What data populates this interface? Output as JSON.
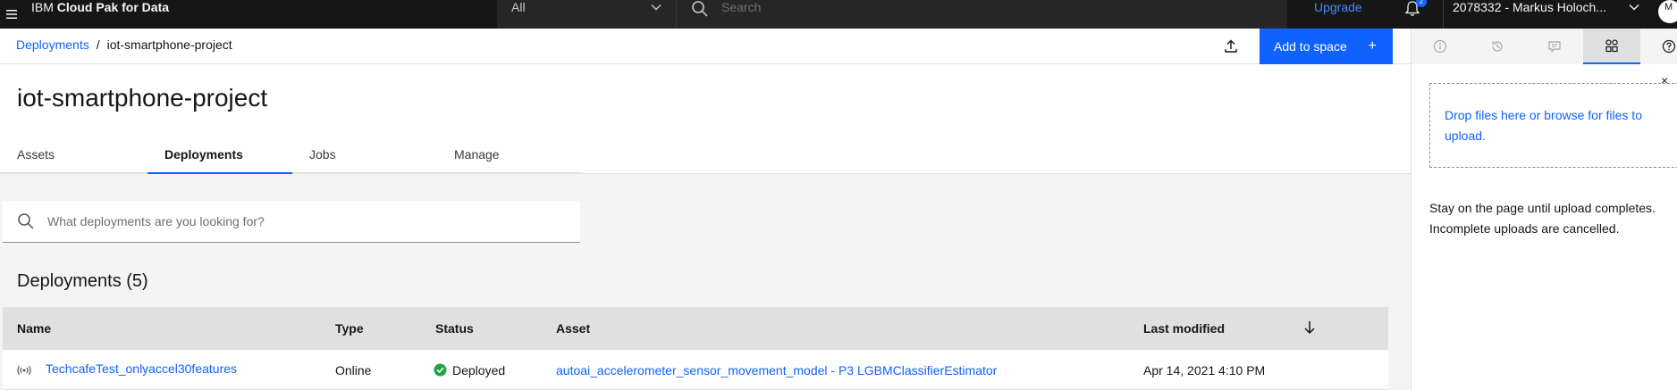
{
  "header": {
    "brand_prefix": "IBM",
    "brand_name": "Cloud Pak for Data",
    "scope_value": "All",
    "search_placeholder": "Search",
    "upgrade_label": "Upgrade",
    "notification_count": "2",
    "account_label": "2078332 - Markus Holoch...",
    "avatar_initial": "M"
  },
  "breadcrumb": {
    "parent": "Deployments",
    "separator": "/",
    "current": "iot-smartphone-project"
  },
  "toolbar": {
    "add_to_space_label": "Add to space",
    "add_icon": "+"
  },
  "page": {
    "title": "iot-smartphone-project",
    "tabs": [
      {
        "label": "Assets",
        "active": false
      },
      {
        "label": "Deployments",
        "active": true
      },
      {
        "label": "Jobs",
        "active": false
      },
      {
        "label": "Manage",
        "active": false
      }
    ]
  },
  "filter": {
    "placeholder": "What deployments are you looking for?"
  },
  "deployments": {
    "section_title": "Deployments (5)",
    "columns": [
      "Name",
      "Type",
      "Status",
      "Asset",
      "Last modified"
    ],
    "rows": [
      {
        "name": "TechcafeTest_onlyaccel30features",
        "type": "Online",
        "status": "Deployed",
        "asset": "autoai_accelerometer_sensor_movement_model - P3 LGBMClassifierEstimator",
        "last_modified": "Apr 14, 2021 4:10 PM"
      }
    ]
  },
  "side_panel": {
    "tabs": [
      "info-icon",
      "history-icon",
      "comment-icon",
      "data-icon",
      "help-icon"
    ],
    "active_tab": "data-icon",
    "dropzone_text": "Drop files here or browse for files to upload.",
    "close_icon": "×",
    "note": "Stay on the page until upload completes. Incomplete uploads are cancelled."
  },
  "colors": {
    "accent": "#0f62fe",
    "header_bg": "#161616",
    "status_success": "#24a148"
  }
}
